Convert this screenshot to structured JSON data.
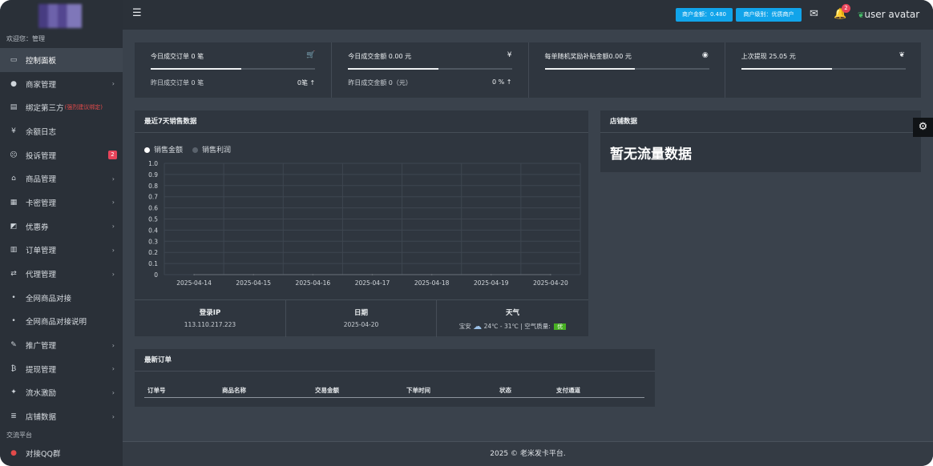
{
  "sidebar": {
    "welcome": "欢迎您：管理",
    "items": [
      {
        "label": "控制面板",
        "icon": "monitor-icon",
        "glyph": "▭",
        "active": true
      },
      {
        "label": "商家管理",
        "icon": "user-circle-icon",
        "glyph": "●",
        "chevron": true
      },
      {
        "label": "绑定第三方",
        "icon": "id-card-icon",
        "glyph": "▤",
        "warn": "(强烈建议绑定)"
      },
      {
        "label": "余额日志",
        "icon": "yen-icon",
        "glyph": "¥"
      },
      {
        "label": "投诉管理",
        "icon": "frown-icon",
        "glyph": "☹",
        "badge": "2"
      },
      {
        "label": "商品管理",
        "icon": "shop-icon",
        "glyph": "⌂",
        "chevron": true
      },
      {
        "label": "卡密管理",
        "icon": "cards-icon",
        "glyph": "▦",
        "chevron": true
      },
      {
        "label": "优惠券",
        "icon": "coupon-icon",
        "glyph": "◩",
        "chevron": true
      },
      {
        "label": "订单管理",
        "icon": "bar-chart-icon",
        "glyph": "▥",
        "chevron": true
      },
      {
        "label": "代理管理",
        "icon": "exchange-icon",
        "glyph": "⇄",
        "chevron": true
      },
      {
        "label": "全网商品对接",
        "icon": "dot-icon",
        "glyph": "•"
      },
      {
        "label": "全网商品对接说明",
        "icon": "dot-icon",
        "glyph": "•"
      },
      {
        "label": "推广管理",
        "icon": "pencil-icon",
        "glyph": "✎",
        "chevron": true
      },
      {
        "label": "提现管理",
        "icon": "bitcoin-icon",
        "glyph": "₿",
        "chevron": true
      },
      {
        "label": "流水激励",
        "icon": "gitlab-icon",
        "glyph": "✦",
        "chevron": true
      },
      {
        "label": "店铺数据",
        "icon": "database-icon",
        "glyph": "≣",
        "chevron": true
      }
    ],
    "section": "交流平台",
    "extra": {
      "label": "对接QQ群",
      "icon": "qq-icon",
      "glyph": "●"
    }
  },
  "topbar": {
    "balance": "商户金额：0.480",
    "level": "商户级别：优质商户",
    "notify_count": "2",
    "avatar_alt": "user avatar"
  },
  "stats": [
    {
      "title": "今日成交订单 0 笔",
      "icon": "cart-icon",
      "glyph": "🛒",
      "progress": 0.55,
      "sub": "昨日成交订单 0 笔",
      "value": "0笔 ↑"
    },
    {
      "title": "今日成交金额 0.00 元",
      "icon": "yen-icon",
      "glyph": "¥",
      "progress": 0.55,
      "sub": "昨日成交金额 0（元）",
      "value": "0 % ↑"
    },
    {
      "title": "每单随机奖励补贴金额0.00 元",
      "icon": "eye-icon",
      "glyph": "◉",
      "progress": 0.55,
      "sub": "",
      "value": ""
    },
    {
      "title": "上次提现 25.05 元",
      "icon": "leaf-icon",
      "glyph": "❦",
      "progress": 0.55,
      "sub": "",
      "value": ""
    }
  ],
  "sales_panel": {
    "title": "最近7天销售数据",
    "legend": [
      {
        "label": "销售金额",
        "color": "#ffffff"
      },
      {
        "label": "销售利润",
        "color": "#5a626c"
      }
    ]
  },
  "chart_data": {
    "type": "line",
    "categories": [
      "2025-04-14",
      "2025-04-15",
      "2025-04-16",
      "2025-04-17",
      "2025-04-18",
      "2025-04-19",
      "2025-04-20"
    ],
    "series": [
      {
        "name": "销售金额",
        "values": [
          0,
          0,
          0,
          0,
          0,
          0,
          0
        ]
      },
      {
        "name": "销售利润",
        "values": [
          0,
          0,
          0,
          0,
          0,
          0,
          0
        ]
      }
    ],
    "yticks": [
      "1.0",
      "0.9",
      "0.8",
      "0.7",
      "0.6",
      "0.5",
      "0.4",
      "0.3",
      "0.2",
      "0.1",
      "0"
    ],
    "ylim": [
      0,
      1
    ],
    "grid": true,
    "legend_position": "top-left"
  },
  "info": {
    "ip_label": "登录IP",
    "ip": "113.110.217.223",
    "date_label": "日期",
    "date": "2025-04-20",
    "weather_label": "天气",
    "city": "宝安",
    "temp": "24℃ - 31℃",
    "aq_label": "| 空气质量:",
    "aq": "优"
  },
  "store_panel": {
    "title": "店铺数据",
    "empty": "暂无流量数据"
  },
  "orders_panel": {
    "title": "最新订单",
    "columns": [
      "订单号",
      "商品名称",
      "交易金额",
      "下单时间",
      "状态",
      "支付通道"
    ]
  },
  "footer": "2025 © 老米发卡平台."
}
